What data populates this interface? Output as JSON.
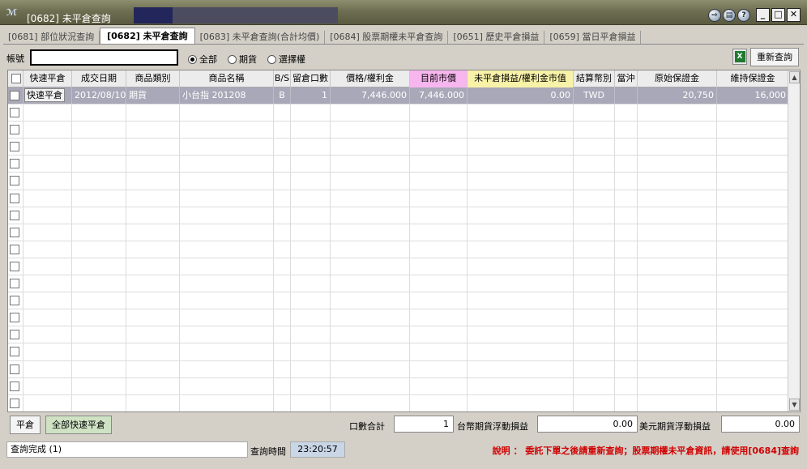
{
  "window": {
    "logo": "ℳ",
    "title": "[0682] 未平倉查詢",
    "icons": [
      "export-icon",
      "print-icon",
      "help-icon"
    ],
    "controls": {
      "minimize": "_",
      "maximize": "□",
      "close": "✕"
    }
  },
  "tabs": [
    {
      "label": "[0681] 部位狀況查詢",
      "active": false
    },
    {
      "label": "[0682] 未平倉查詢",
      "active": true
    },
    {
      "label": "[0683] 未平倉查詢(合計均價)",
      "active": false
    },
    {
      "label": "[0684] 股票期權未平倉查詢",
      "active": false
    },
    {
      "label": "[0651] 歷史平倉損益",
      "active": false
    },
    {
      "label": "[0659] 當日平倉損益",
      "active": false
    }
  ],
  "toolbar": {
    "account_label": "帳號",
    "account_value": "",
    "radio_all": "全部",
    "radio_futures": "期貨",
    "radio_options": "選擇權",
    "selected_radio": "all",
    "excel_label": "X",
    "requery_label": "重新查詢"
  },
  "table": {
    "headers": [
      "",
      "快速平倉",
      "成交日期",
      "商品類別",
      "商品名稱",
      "B/S",
      "留倉口數",
      "價格/權利金",
      "目前市價",
      "未平倉損益/權利金市值",
      "結算幣別",
      "當沖",
      "原始保證金",
      "維持保證金"
    ],
    "header_colors": {
      "current_price": "#f7b6ee",
      "unrealized": "#f8f2a8"
    },
    "rows": [
      {
        "quick_close": "快速平倉",
        "trade_date": "2012/08/10",
        "category": "期貨",
        "product": "小台指 201208",
        "bs": "B",
        "qty": "1",
        "price": "7,446.000",
        "market": "7,446.000",
        "pnl": "0.00",
        "currency": "TWD",
        "daytrade": "",
        "init_margin": "20,750",
        "maint_margin": "16,000"
      }
    ],
    "empty_row_count": 18
  },
  "bottom": {
    "close_label": "平倉",
    "close_all_label": "全部快速平倉",
    "qty_total_label": "口數合計",
    "qty_total_value": "1",
    "twd_pnl_label": "台幣期貨浮動損益",
    "twd_pnl_value": "0.00",
    "usd_pnl_label": "美元期貨浮動損益",
    "usd_pnl_value": "0.00"
  },
  "status": {
    "message": "查詢完成 (1)",
    "time_label": "查詢時間",
    "time_value": "23:20:57",
    "note": "說明 ： 委託下單之後請重新查詢；股票期權未平倉資訊，請使用[0684]查詢"
  }
}
